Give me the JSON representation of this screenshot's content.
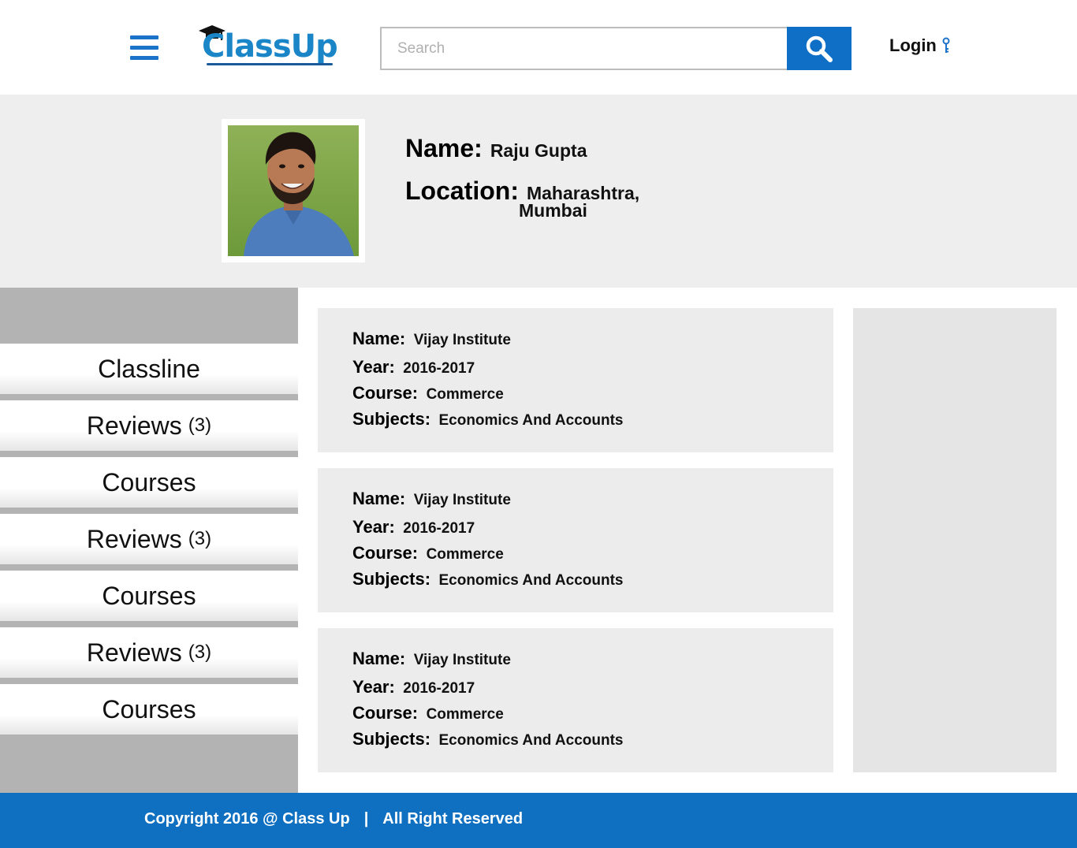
{
  "header": {
    "logo_text": "ClassUp",
    "search_placeholder": "Search",
    "login_label": "Login"
  },
  "profile": {
    "name_label": "Name:",
    "name_value": "Raju Gupta",
    "location_label": "Location:",
    "location_line1": "Maharashtra,",
    "location_line2": "Mumbai"
  },
  "sidebar": {
    "items": [
      {
        "label": "Classline",
        "count": ""
      },
      {
        "label": "Reviews",
        "count": "(3)"
      },
      {
        "label": "Courses",
        "count": ""
      },
      {
        "label": "Reviews",
        "count": "(3)"
      },
      {
        "label": "Courses",
        "count": ""
      },
      {
        "label": "Reviews",
        "count": "(3)"
      },
      {
        "label": "Courses",
        "count": ""
      }
    ]
  },
  "cards": [
    {
      "name_label": "Name:",
      "name": "Vijay Institute",
      "year_label": "Year:",
      "year": "2016-2017",
      "course_label": "Course:",
      "course": "Commerce",
      "subjects_label": "Subjects:",
      "subjects": "Economics And Accounts"
    },
    {
      "name_label": "Name:",
      "name": "Vijay Institute",
      "year_label": "Year:",
      "year": "2016-2017",
      "course_label": "Course:",
      "course": "Commerce",
      "subjects_label": "Subjects:",
      "subjects": "Economics And Accounts"
    },
    {
      "name_label": "Name:",
      "name": "Vijay Institute",
      "year_label": "Year:",
      "year": "2016-2017",
      "course_label": "Course:",
      "course": "Commerce",
      "subjects_label": "Subjects:",
      "subjects": "Economics And Accounts"
    }
  ],
  "footer": {
    "copyright": "Copyright 2016 @ Class Up",
    "separator": "|",
    "rights": "All Right Reserved"
  },
  "icons": {
    "menu": "hamburger-menu-icon",
    "search": "search-icon",
    "login": "key-icon",
    "logo_cap": "graduation-cap-icon"
  },
  "colors": {
    "brand_blue": "#0f6fc6",
    "logo_blue": "#1a86c8",
    "band_gray": "#eeeeee",
    "sidebar_gray": "#b3b3b3",
    "card_gray": "#ececec"
  }
}
